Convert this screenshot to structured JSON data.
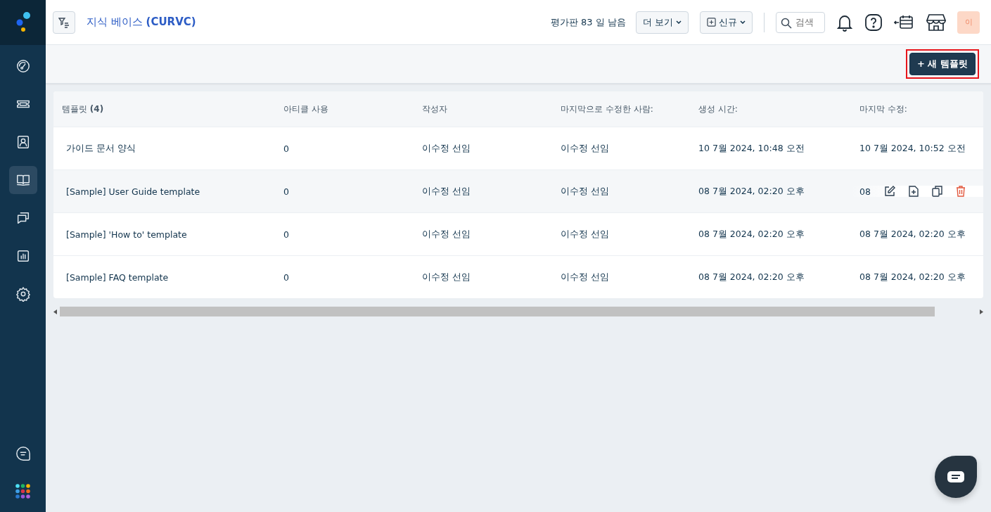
{
  "sidebar": {
    "items": [
      {
        "kind": "gauge",
        "selected": false
      },
      {
        "kind": "ticket",
        "selected": false
      },
      {
        "kind": "contact",
        "selected": false
      },
      {
        "kind": "book",
        "selected": true
      },
      {
        "kind": "chat",
        "selected": false
      },
      {
        "kind": "chart",
        "selected": false
      },
      {
        "kind": "gear",
        "selected": false
      }
    ]
  },
  "header": {
    "title": "지식 베이스",
    "title_suffix": "(CURVC)",
    "trial": "평가판 83 일 남음",
    "more_button": "더 보기",
    "new_button": "신규",
    "search": {
      "placeholder": "검색"
    },
    "avatar": "이"
  },
  "toolbar": {
    "new_template_button": "+ 새 템플릿",
    "highlighted": true
  },
  "table": {
    "columns": [
      "템플릿 **(4)**",
      "아티클 사용",
      "작성자",
      "마지막으로 수정한 사람:",
      "생성 시간:",
      "마지막 수정:"
    ],
    "rows": [
      {
        "cells": [
          "가이드 문서 양식",
          "0",
          "이수정 선임",
          "이수정 선임",
          "10 7월 2024, 10:48 오전",
          "10 7월 2024, 10:52 오전"
        ],
        "hovered": false
      },
      {
        "cells": [
          "[Sample] User Guide template",
          "0",
          "이수정 선임",
          "이수정 선임",
          "08 7월 2024, 02:20 오후",
          "08"
        ],
        "hovered": true
      },
      {
        "cells": [
          "[Sample] 'How to' template",
          "0",
          "이수정 선임",
          "이수정 선임",
          "08 7월 2024, 02:20 오후",
          "08 7월 2024, 02:20 오후"
        ],
        "hovered": false
      },
      {
        "cells": [
          "[Sample] FAQ template",
          "0",
          "이수정 선임",
          "이수정 선임",
          "08 7월 2024, 02:20 오후",
          "08 7월 2024, 02:20 오후"
        ],
        "hovered": false
      }
    ]
  }
}
